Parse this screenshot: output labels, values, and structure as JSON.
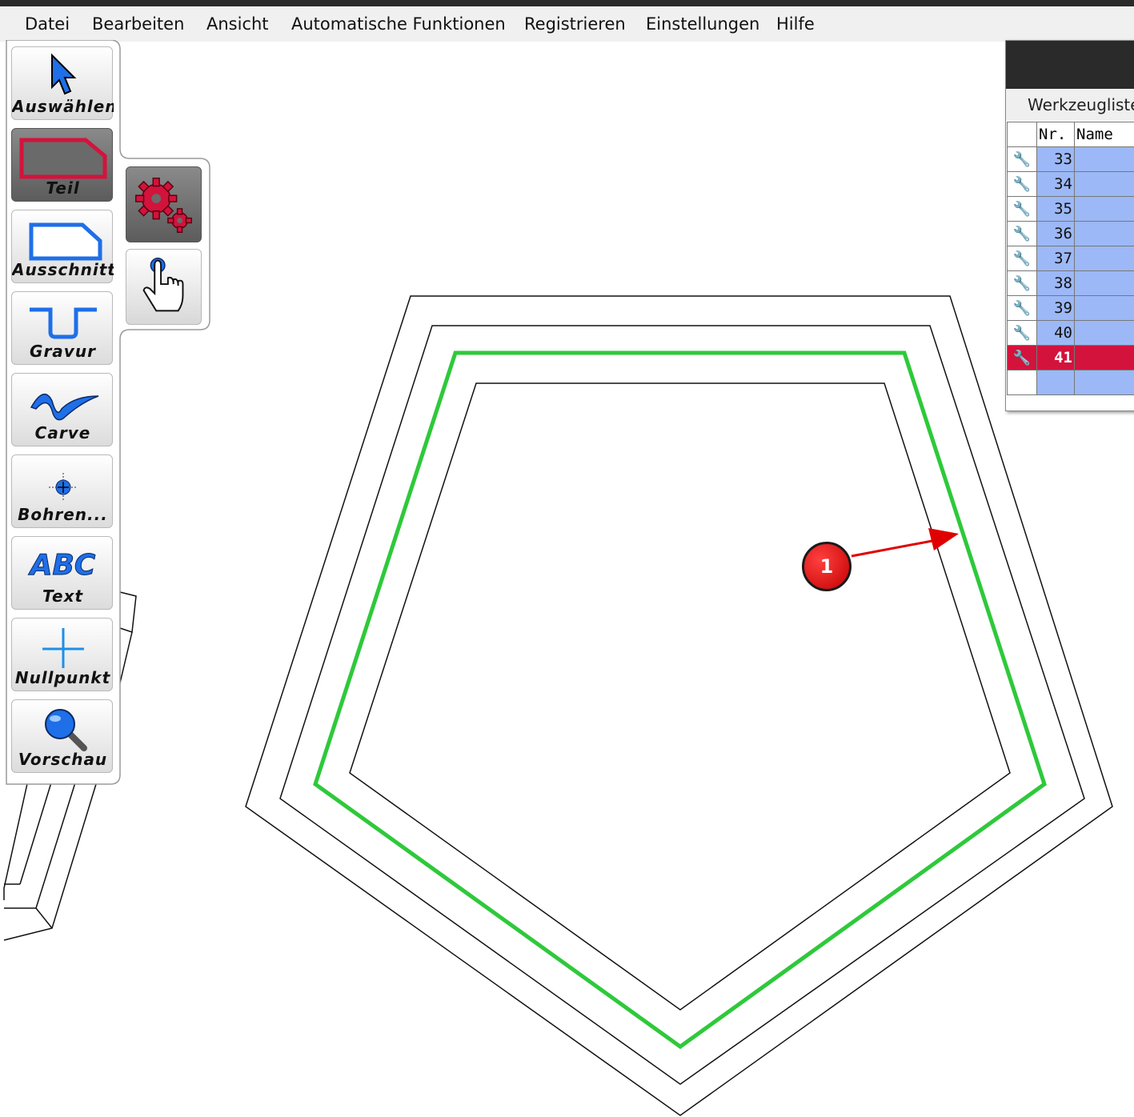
{
  "menu": {
    "items": [
      "Datei",
      "Bearbeiten",
      "Ansicht",
      "Automatische Funktionen",
      "Registrieren",
      "Einstellungen",
      "Hilfe"
    ]
  },
  "toolbar": {
    "tools": [
      {
        "label": "Auswählen",
        "icon": "arrow-cursor-icon",
        "active": false
      },
      {
        "label": "Teil",
        "icon": "part-outline-icon",
        "active": true
      },
      {
        "label": "Ausschnitt",
        "icon": "pocket-outline-icon",
        "active": false
      },
      {
        "label": "Gravur",
        "icon": "engrave-groove-icon",
        "active": false
      },
      {
        "label": "Carve",
        "icon": "carve-wave-icon",
        "active": false
      },
      {
        "label": "Bohren...",
        "icon": "drill-target-icon",
        "active": false
      },
      {
        "label": "Text",
        "icon": "abc-text-icon",
        "icon_text": "ABC",
        "active": false
      },
      {
        "label": "Nullpunkt",
        "icon": "origin-cross-icon",
        "active": false
      },
      {
        "label": "Vorschau",
        "icon": "magnifier-icon",
        "active": false
      }
    ],
    "subtools": [
      {
        "icon": "gears-icon",
        "active": true
      },
      {
        "icon": "hand-pointer-icon",
        "active": false
      }
    ]
  },
  "tool_panel": {
    "subtitle": "Werkzeugliste",
    "columns": [
      "",
      "Nr.",
      "Name"
    ],
    "rows": [
      {
        "nr": "33",
        "name": "",
        "selected": false
      },
      {
        "nr": "34",
        "name": "",
        "selected": false
      },
      {
        "nr": "35",
        "name": "",
        "selected": false
      },
      {
        "nr": "36",
        "name": "",
        "selected": false
      },
      {
        "nr": "37",
        "name": "",
        "selected": false
      },
      {
        "nr": "38",
        "name": "",
        "selected": false
      },
      {
        "nr": "39",
        "name": "",
        "selected": false
      },
      {
        "nr": "40",
        "name": "",
        "selected": false
      },
      {
        "nr": "41",
        "name": "",
        "selected": true
      },
      {
        "nr": "",
        "name": "",
        "selected": false
      }
    ]
  },
  "annotation": {
    "badge": "1"
  },
  "colors": {
    "toolpath": "#2ec93a",
    "selected_row": "#d3133c",
    "row_bg": "#9cb8f6",
    "annotation_red": "#e00000",
    "icon_blue": "#1e6fe8"
  }
}
